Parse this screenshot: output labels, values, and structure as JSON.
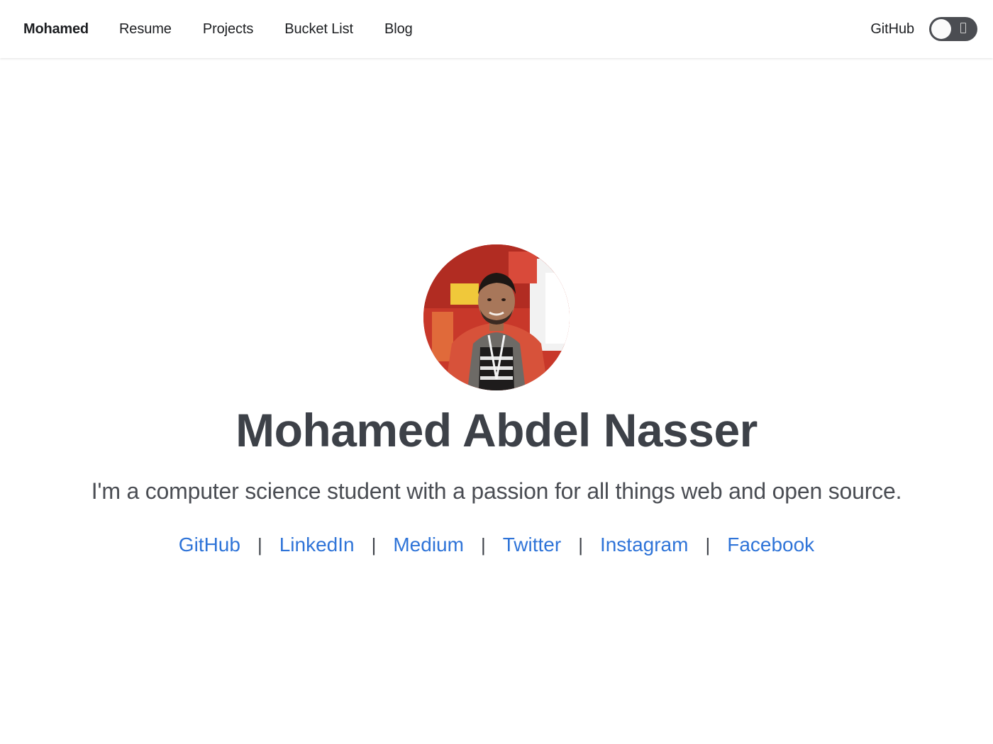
{
  "nav": {
    "brand": "Mohamed",
    "links": [
      "Resume",
      "Projects",
      "Bucket List",
      "Blog"
    ],
    "github": "GitHub"
  },
  "hero": {
    "name": "Mohamed Abdel Nasser",
    "tagline": "I'm a computer science student with a passion for all things web and open source.",
    "socials": [
      "GitHub",
      "LinkedIn",
      "Medium",
      "Twitter",
      "Instagram",
      "Facebook"
    ],
    "separator": "|"
  },
  "colors": {
    "link": "#2f74d8",
    "heading": "#3d4148",
    "toggle": "#4b4d52"
  },
  "theme_toggle": {
    "state": "off"
  }
}
